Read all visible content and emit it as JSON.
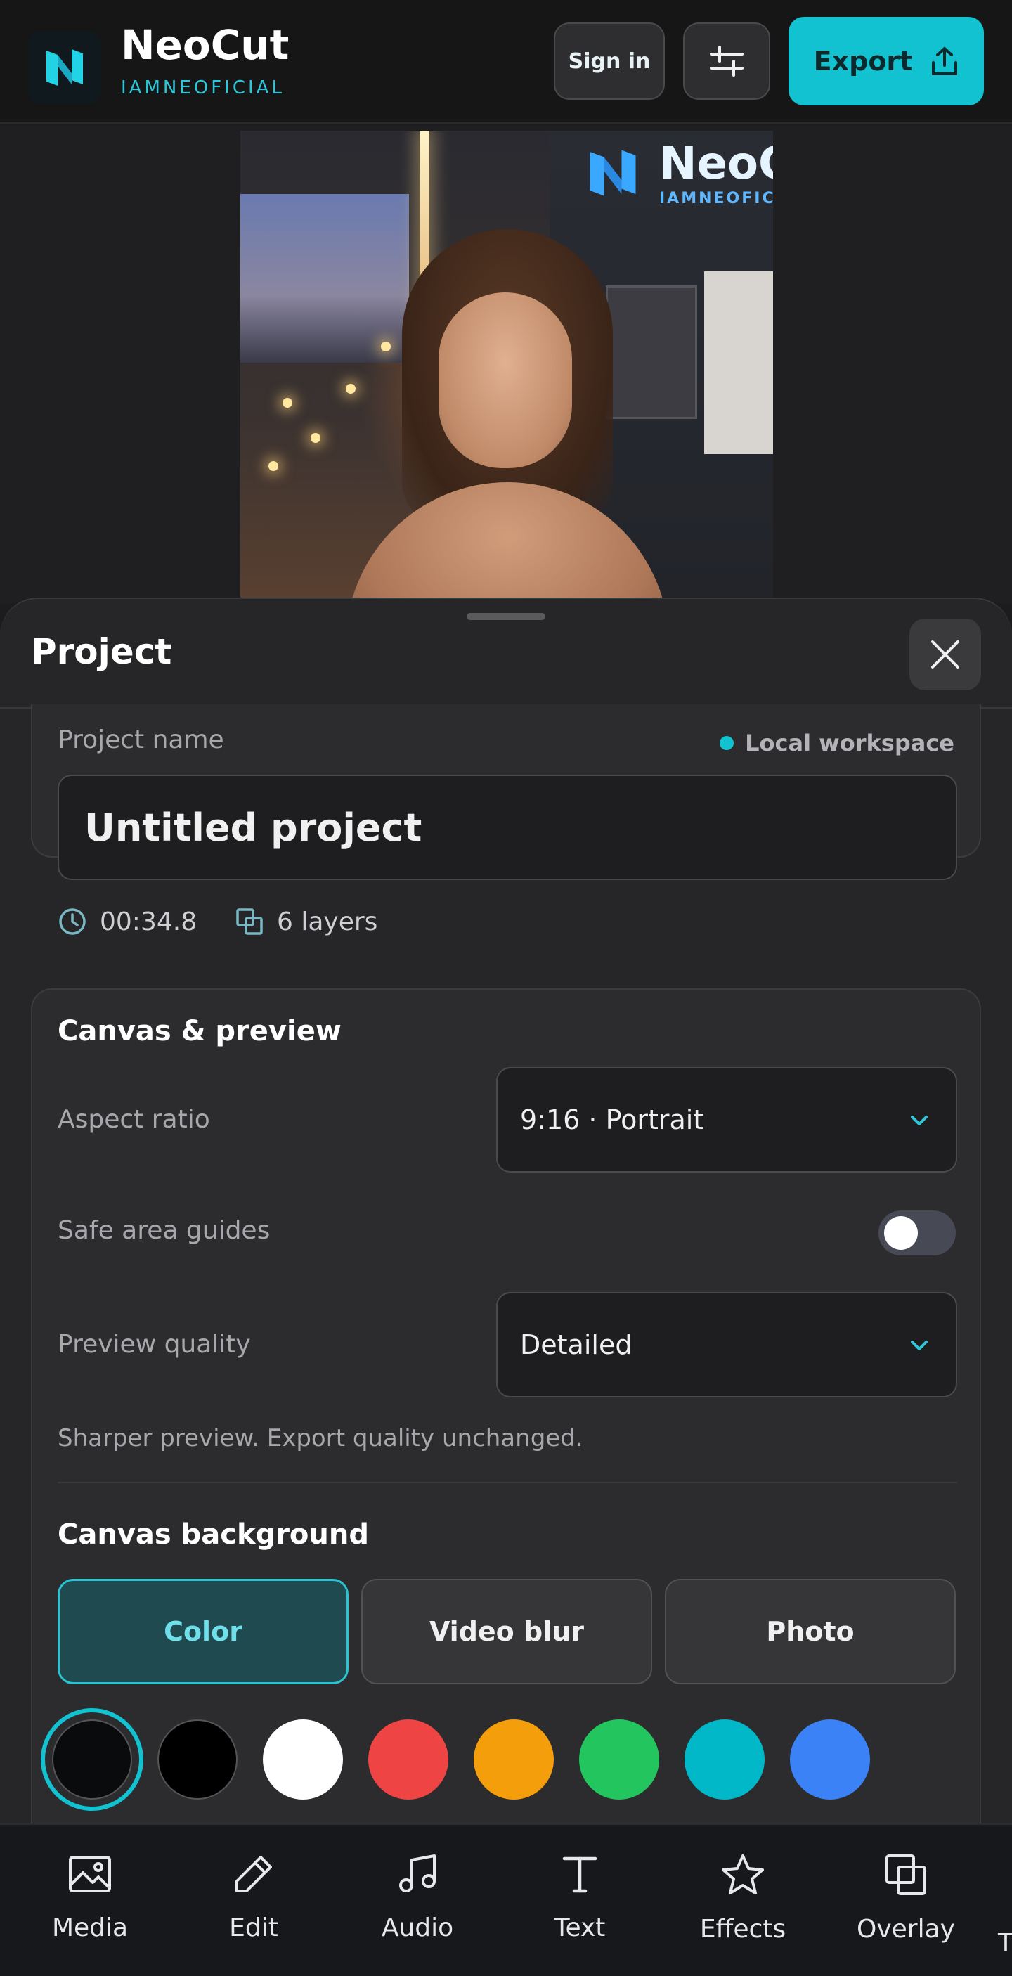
{
  "header": {
    "app_name": "NeoCut",
    "app_subtitle": "IAMNEOFICIAL",
    "sign_in_label": "Sign in",
    "export_label": "Export",
    "accent": "#12c2d0"
  },
  "preview": {
    "brand_text": "NeoC",
    "brand_sub": "IAMNEOFIC"
  },
  "sheet": {
    "title": "Project",
    "project": {
      "name_label": "Project name",
      "workspace_label": "Local workspace",
      "name_value": "Untitled project",
      "duration": "00:34.8",
      "layers": "6 layers"
    },
    "canvas": {
      "title": "Canvas & preview",
      "aspect_label": "Aspect ratio",
      "aspect_value": "9:16 · Portrait",
      "safe_area_label": "Safe area guides",
      "safe_area_on": false,
      "quality_label": "Preview quality",
      "quality_value": "Detailed",
      "quality_hint": "Sharper preview. Export quality unchanged.",
      "background_title": "Canvas background",
      "background_options": [
        "Color",
        "Video blur",
        "Photo"
      ],
      "background_selected": "Color",
      "swatches": [
        "#0a0b0d",
        "#000000",
        "#ffffff",
        "#ef4444",
        "#f59e0b",
        "#22c55e",
        "#00b8c8",
        "#3b82f6"
      ],
      "swatch_selected": "#0a0b0d"
    }
  },
  "bottom_nav": {
    "items": [
      {
        "label": "Media",
        "icon": "image-icon"
      },
      {
        "label": "Edit",
        "icon": "pencil-icon"
      },
      {
        "label": "Audio",
        "icon": "music-note-icon"
      },
      {
        "label": "Text",
        "icon": "text-icon"
      },
      {
        "label": "Effects",
        "icon": "star-icon"
      },
      {
        "label": "Overlay",
        "icon": "overlay-icon"
      }
    ],
    "cut_off": "T"
  }
}
